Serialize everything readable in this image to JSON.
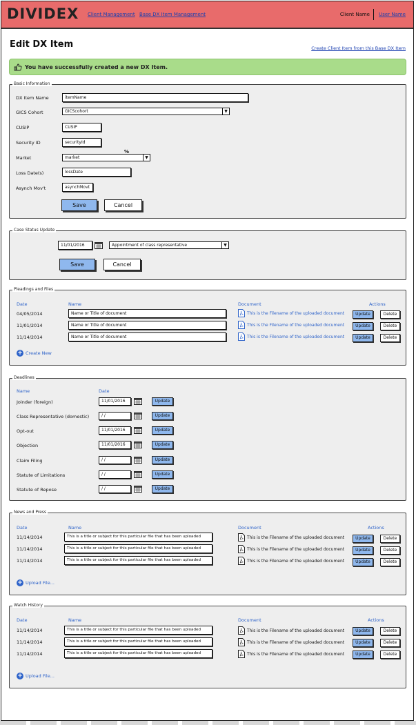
{
  "header": {
    "logo": "DIVIDEX",
    "nav": [
      "Client Management",
      "Base DX Item Management"
    ],
    "client_name": "Client Name",
    "user_name": "User Name"
  },
  "page": {
    "title": "Edit DX Item",
    "create_link": "Create Client Item from this Base DX Item",
    "alert": "You have successfully created a new DX Item."
  },
  "basic": {
    "legend": "Basic Information",
    "labels": [
      "DX Item Name",
      "GICS Cohort",
      "CUSIP",
      "Security ID",
      "Market",
      "Loss Date(s)",
      "Asynch Mov't"
    ],
    "values": {
      "item_name": "itemName",
      "gics": "GICScohort",
      "cusip": "CUSIP",
      "security": "securityId",
      "market": "market",
      "loss": "lossDate",
      "asynch": "asynchMovt"
    },
    "percent": "%",
    "save": "Save",
    "cancel": "Cancel"
  },
  "case": {
    "legend": "Case Status Update",
    "date": "11/01/2016",
    "status": "Appointment of class representative",
    "save": "Save",
    "cancel": "Cancel"
  },
  "pleadings": {
    "legend": "Pleadings and Files",
    "headers": {
      "date": "Date",
      "name": "Name",
      "document": "Document",
      "actions": "Actions"
    },
    "rows": [
      {
        "date": "04/05/2014",
        "name": "Name or Title of document",
        "doc": "This is the Filename of the uploaded document"
      },
      {
        "date": "11/01/2014",
        "name": "Name or Title of document",
        "doc": "This is the Filename of the uploaded document"
      },
      {
        "date": "11/14/2014",
        "name": "Name or Title of document",
        "doc": "This is the Filename of the uploaded document"
      }
    ],
    "update": "Update",
    "delete": "Delete",
    "create_new": "Create New"
  },
  "deadlines": {
    "legend": "Deadlines",
    "headers": {
      "name": "Name",
      "date": "Date"
    },
    "rows": [
      {
        "name": "Joinder (foreign)",
        "date": "11/01/2016"
      },
      {
        "name": "Class Representative (domestic)",
        "date": "/  /"
      },
      {
        "name": "Opt-out",
        "date": "11/01/2016"
      },
      {
        "name": "Objection",
        "date": "11/01/2016"
      },
      {
        "name": "Claim Filing",
        "date": "/  /"
      },
      {
        "name": "Statute of Limitations",
        "date": "/  /"
      },
      {
        "name": "Statute of Repose",
        "date": "/  /"
      }
    ],
    "update": "Update"
  },
  "news": {
    "legend": "News and Press",
    "headers": {
      "date": "Date",
      "name": "Name",
      "document": "Document",
      "actions": "Actions"
    },
    "rows": [
      {
        "date": "11/14/2014",
        "name": "This is a title or subject for this particular file that has been uploaded",
        "doc": "This is the Filename of the uploaded document"
      },
      {
        "date": "11/14/2014",
        "name": "This is a title or subject for this particular file that has been uploaded",
        "doc": "This is the Filename of the uploaded document"
      },
      {
        "date": "11/14/2014",
        "name": "This is a title or subject for this particular file that has been uploaded",
        "doc": "This is the Filename of the uploaded document"
      }
    ],
    "update": "Update",
    "delete": "Delete",
    "upload": "Upload File..."
  },
  "watch": {
    "legend": "Watch History",
    "headers": {
      "date": "Date",
      "name": "Name",
      "document": "Document",
      "actions": "Actions"
    },
    "rows": [
      {
        "date": "11/14/2014",
        "name": "This is a title or subject for this particular file that has been uploaded",
        "doc": "This is the Filename of the uploaded document"
      },
      {
        "date": "11/14/2014",
        "name": "This is a title or subject for this particular file that has been uploaded",
        "doc": "This is the Filename of the uploaded document"
      },
      {
        "date": "11/14/2014",
        "name": "This is a title or subject for this particular file that has been uploaded",
        "doc": "This is the Filename of the uploaded document"
      }
    ],
    "update": "Update",
    "delete": "Delete",
    "upload": "Upload File..."
  }
}
